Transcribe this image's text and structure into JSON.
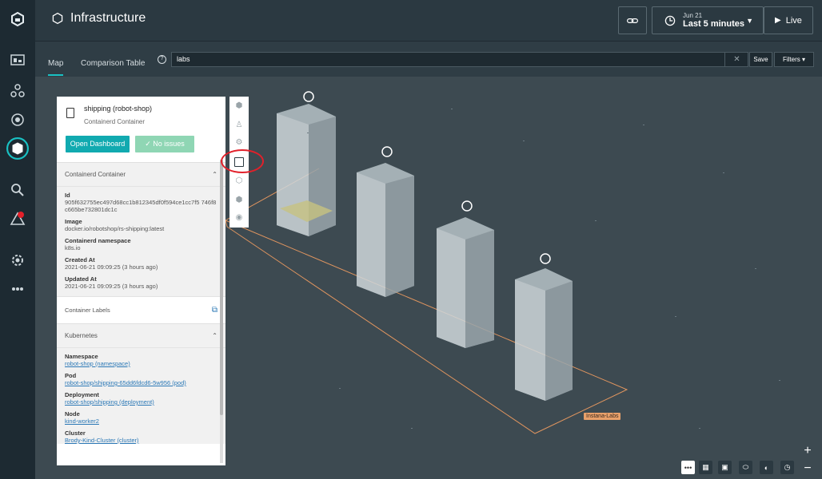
{
  "header": {
    "title": "Infrastructure"
  },
  "time": {
    "date": "Jun 21",
    "range": "Last 5 minutes",
    "live_label": "Live"
  },
  "tabs": [
    {
      "label": "Map"
    },
    {
      "label": "Comparison Table"
    }
  ],
  "search": {
    "value": "labs",
    "save_label": "Save",
    "filters_label": "Filters"
  },
  "panel": {
    "title": "shipping (robot-shop)",
    "subtitle": "Containerd Container",
    "open_dashboard": "Open Dashboard",
    "no_issues": "No issues",
    "section1": "Containerd Container",
    "fields": [
      {
        "label": "Id",
        "value": "905f632755ec497d68cc1b812345df0f594ce1cc7f5 746f8c665be732801dc1c"
      },
      {
        "label": "Image",
        "value": "docker.io/robotshop/rs-shipping:latest"
      },
      {
        "label": "Containerd namespace",
        "value": "k8s.io"
      },
      {
        "label": "Created At",
        "value": "2021-06-21 09:09:25 (3 hours ago)"
      },
      {
        "label": "Updated At",
        "value": "2021-06-21 09:09:25 (3 hours ago)"
      }
    ],
    "container_labels": "Container Labels",
    "section2": "Kubernetes",
    "k8s": [
      {
        "label": "Namespace",
        "value": "robot-shop (namespace)"
      },
      {
        "label": "Pod",
        "value": "robot-shop/shipping-65dd6fdcd6-5w956 (pod)"
      },
      {
        "label": "Deployment",
        "value": "robot-shop/shipping (deployment)"
      },
      {
        "label": "Node",
        "value": "kind-worker2"
      },
      {
        "label": "Cluster",
        "value": "Brody-Kind-Cluster (cluster)"
      }
    ]
  },
  "map": {
    "zone_label": "Instana-Labs"
  },
  "colors": {
    "accent": "#19c1c3",
    "ok": "#8fd6b4",
    "alert": "#e2202a",
    "zone": "#e8a06a"
  }
}
